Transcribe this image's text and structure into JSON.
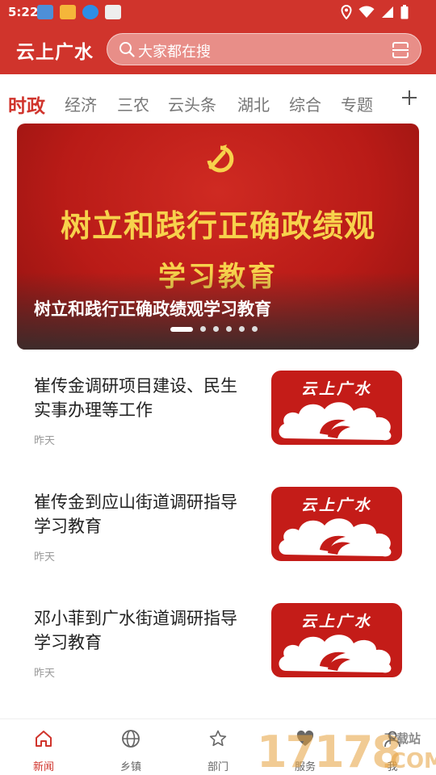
{
  "status_bar": {
    "time": "5:22",
    "notification_icons": [
      "app-notification-icon",
      "app-notification-icon",
      "download-notification-icon",
      "app-notification-icon"
    ],
    "right_icons": [
      "location-icon",
      "wifi-icon",
      "signal-icon",
      "battery-icon"
    ]
  },
  "header": {
    "brand": "云上广水",
    "search_placeholder": "大家都在搜",
    "accent_color": "#d0342c"
  },
  "tabs": [
    "时政",
    "经济",
    "三农",
    "云头条",
    "湖北",
    "综合",
    "专题"
  ],
  "active_tab_index": 0,
  "banner": {
    "image_title": "树立和践行正确政绩观",
    "image_subtitle": "学习教育",
    "caption": "树立和践行正确政绩观学习教育",
    "page_count": 6,
    "active_page": 0
  },
  "news": [
    {
      "title": "崔传金调研项目建设、民生实事办理等工作",
      "time": "昨天",
      "thumb_text": "云上广水"
    },
    {
      "title": "崔传金到应山街道调研指导学习教育",
      "time": "昨天",
      "thumb_text": "云上广水"
    },
    {
      "title": "邓小菲到广水街道调研指导学习教育",
      "time": "昨天",
      "thumb_text": "云上广水"
    }
  ],
  "bottom_nav": [
    {
      "label": "新闻",
      "icon": "home-icon",
      "active": true
    },
    {
      "label": "乡镇",
      "icon": "globe-icon",
      "active": false
    },
    {
      "label": "部门",
      "icon": "star-icon",
      "active": false
    },
    {
      "label": "服务",
      "icon": "heart-icon",
      "active": false
    },
    {
      "label": "我",
      "icon": "user-icon",
      "active": false
    }
  ],
  "watermark": {
    "number": "17178",
    "domain": ".COM",
    "site": "下载站"
  }
}
